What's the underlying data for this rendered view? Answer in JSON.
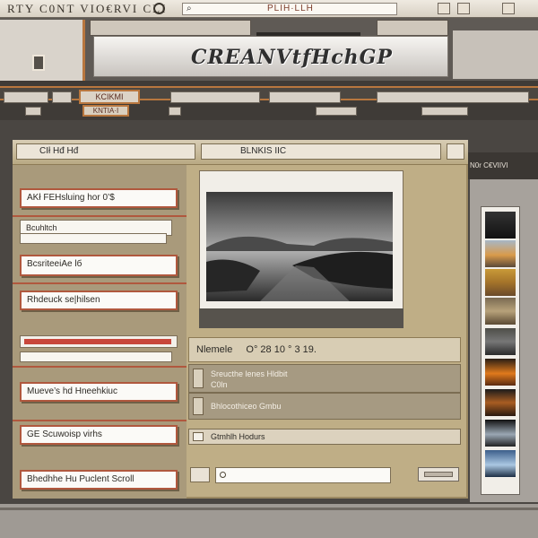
{
  "menubar": {
    "text": "RTY C0NT VIO€RVI CLI",
    "search_glyph": "⌕",
    "search_text": "PLIH·LLH"
  },
  "brand": {
    "text": "CREANVtfHchGP"
  },
  "toolbar": {
    "label_1": "KCIKMI",
    "label_2": "KNTIA·I"
  },
  "right_bar": {
    "label": "N0r C€VIIVI"
  },
  "dialog": {
    "header_label": "CIł Hđ Hđ",
    "header_label_2": "BLNKIS IIC",
    "fields": [
      "AKł FEHsluing hor 0’$",
      "Bcuhltch",
      "BcsriteeiAe lб",
      "Rhdeuck se|hilsen",
      "Mueve’s hd Hneehkiuc",
      "GE Scuwoisp virhs",
      "Bhedhhe Hu Puclent Scroll"
    ]
  },
  "info": {
    "row1_label": "Nlemele",
    "row1_values": "O° 28 10 ° 3 19.",
    "row2_line1": "Sreucthe lenes Hldbit",
    "row2_line2": "C0ln",
    "row3": "Bhlocothiceo Gmbu",
    "row4": "Gtmhlh Hodurs"
  },
  "colors": {
    "accent_orange": "#b8773f",
    "field_red": "#b0583e",
    "dialog_tan": "#bfae86"
  },
  "icons": {
    "circle": "circle-icon",
    "lock": "lock-icon",
    "search": "search-icon"
  }
}
